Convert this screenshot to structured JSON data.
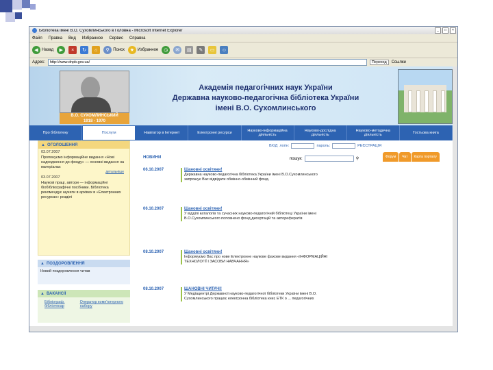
{
  "window": {
    "title": "Бібліотека імені В.О. Сухомлинського в Головна - Microsoft Internet Explorer"
  },
  "menu": [
    "Файл",
    "Правка",
    "Вид",
    "Избранное",
    "Сервис",
    "Справка"
  ],
  "toolbar": {
    "back": "Назад",
    "search": "Поиск",
    "favorites": "Избранное"
  },
  "address": {
    "label": "Адрес:",
    "url": "http://www.dnpb.gov.ua/",
    "go": "Переход",
    "links": "Ссылки"
  },
  "header": {
    "portrait_name": "В.О. СУХОМЛИНСЬКИЙ",
    "portrait_years": "1918 - 1970",
    "academy_line1": "Академія педагогічних наук України",
    "academy_line2": "Державна науково-педагогічна бібліотека України",
    "academy_line3": "імені В.О. Сухомлинського"
  },
  "nav": [
    "Про бібліотеку",
    "Послуги",
    "Навігатор в Інтернет",
    "Електронні ресурси",
    "Науково-інформаційна діяльність",
    "Науково-дослідна діяльність",
    "Науково-методична діяльність",
    "Гостьова книга"
  ],
  "login": {
    "enter": "ВХІД",
    "login_label": "логін:",
    "password_label": "пароль:",
    "register": "РЕЄСТРАЦІЯ"
  },
  "search": {
    "label": "пошук:"
  },
  "orange_tabs": [
    "Форум",
    "Чат",
    "Карта порталу"
  ],
  "left": {
    "announcements_title": "ОГОЛОШЕННЯ",
    "ann1_date": "03.07.2007",
    "ann1_text": "Пропонуємо інформаційне видання «Нові надходження до фонду» — основні видання на матеріалах",
    "ann1_more": "детальніше",
    "ann2_date": "03.07.2007",
    "ann2_text": "Наукові праці, автори — інформаційні біобібліографічні посібники. Бібліотека рекомендує шукати в архівах в «Електронних ресурсах» розділі",
    "congrats_title": "ПОЗДОРОВЛЕННЯ",
    "congrats_text": "Новий поздоровлення читав",
    "vacancies_title": "ВАКАНСІЇ",
    "vacancy_link1": "Бібліограф, бібліотекар",
    "vacancy_link2": "Оператор комп'ютерного набору"
  },
  "main": {
    "news_heading": "НОВИНИ",
    "news": [
      {
        "date": "06.10.2007",
        "title": "Шановні освітяни!",
        "text": "Державна науково-педагогічна бібліотека України імені В.О.Сухомлинського запрошує Вас відвідати обмінно-обмінний фонд."
      },
      {
        "date": "06.10.2007",
        "title": "Шановні освітяни!",
        "text": "У відділі каталогів та сучасних науково-педагогічній бібліотеці України імені В.О.Сухомлинського поповнено фонд дисертацій та авторефератів"
      },
      {
        "date": "08.10.2007",
        "title": "Шановні освітяни!",
        "text": "Інформуємо Вас про нове Електронне наукове фахове видання «ІНФОРМАЦІЙНІ ТЕХНОЛОГІЇ І ЗАСОБИ НАВЧАННЯ»"
      },
      {
        "date": "08.10.2007",
        "title": "ШАНОВНІ ЧИТАЧІ!",
        "text": "У Медіацентрі Державної науково-педагогічної бібліотеки України імені В.О. Сухомлинського працює електронна бібліотека книг, ЕТК о ... педагогічних"
      }
    ]
  },
  "colors": {
    "nav": "#2d63b2",
    "accent_orange": "#f09a2a",
    "news_panel": "#fdf6c9"
  }
}
